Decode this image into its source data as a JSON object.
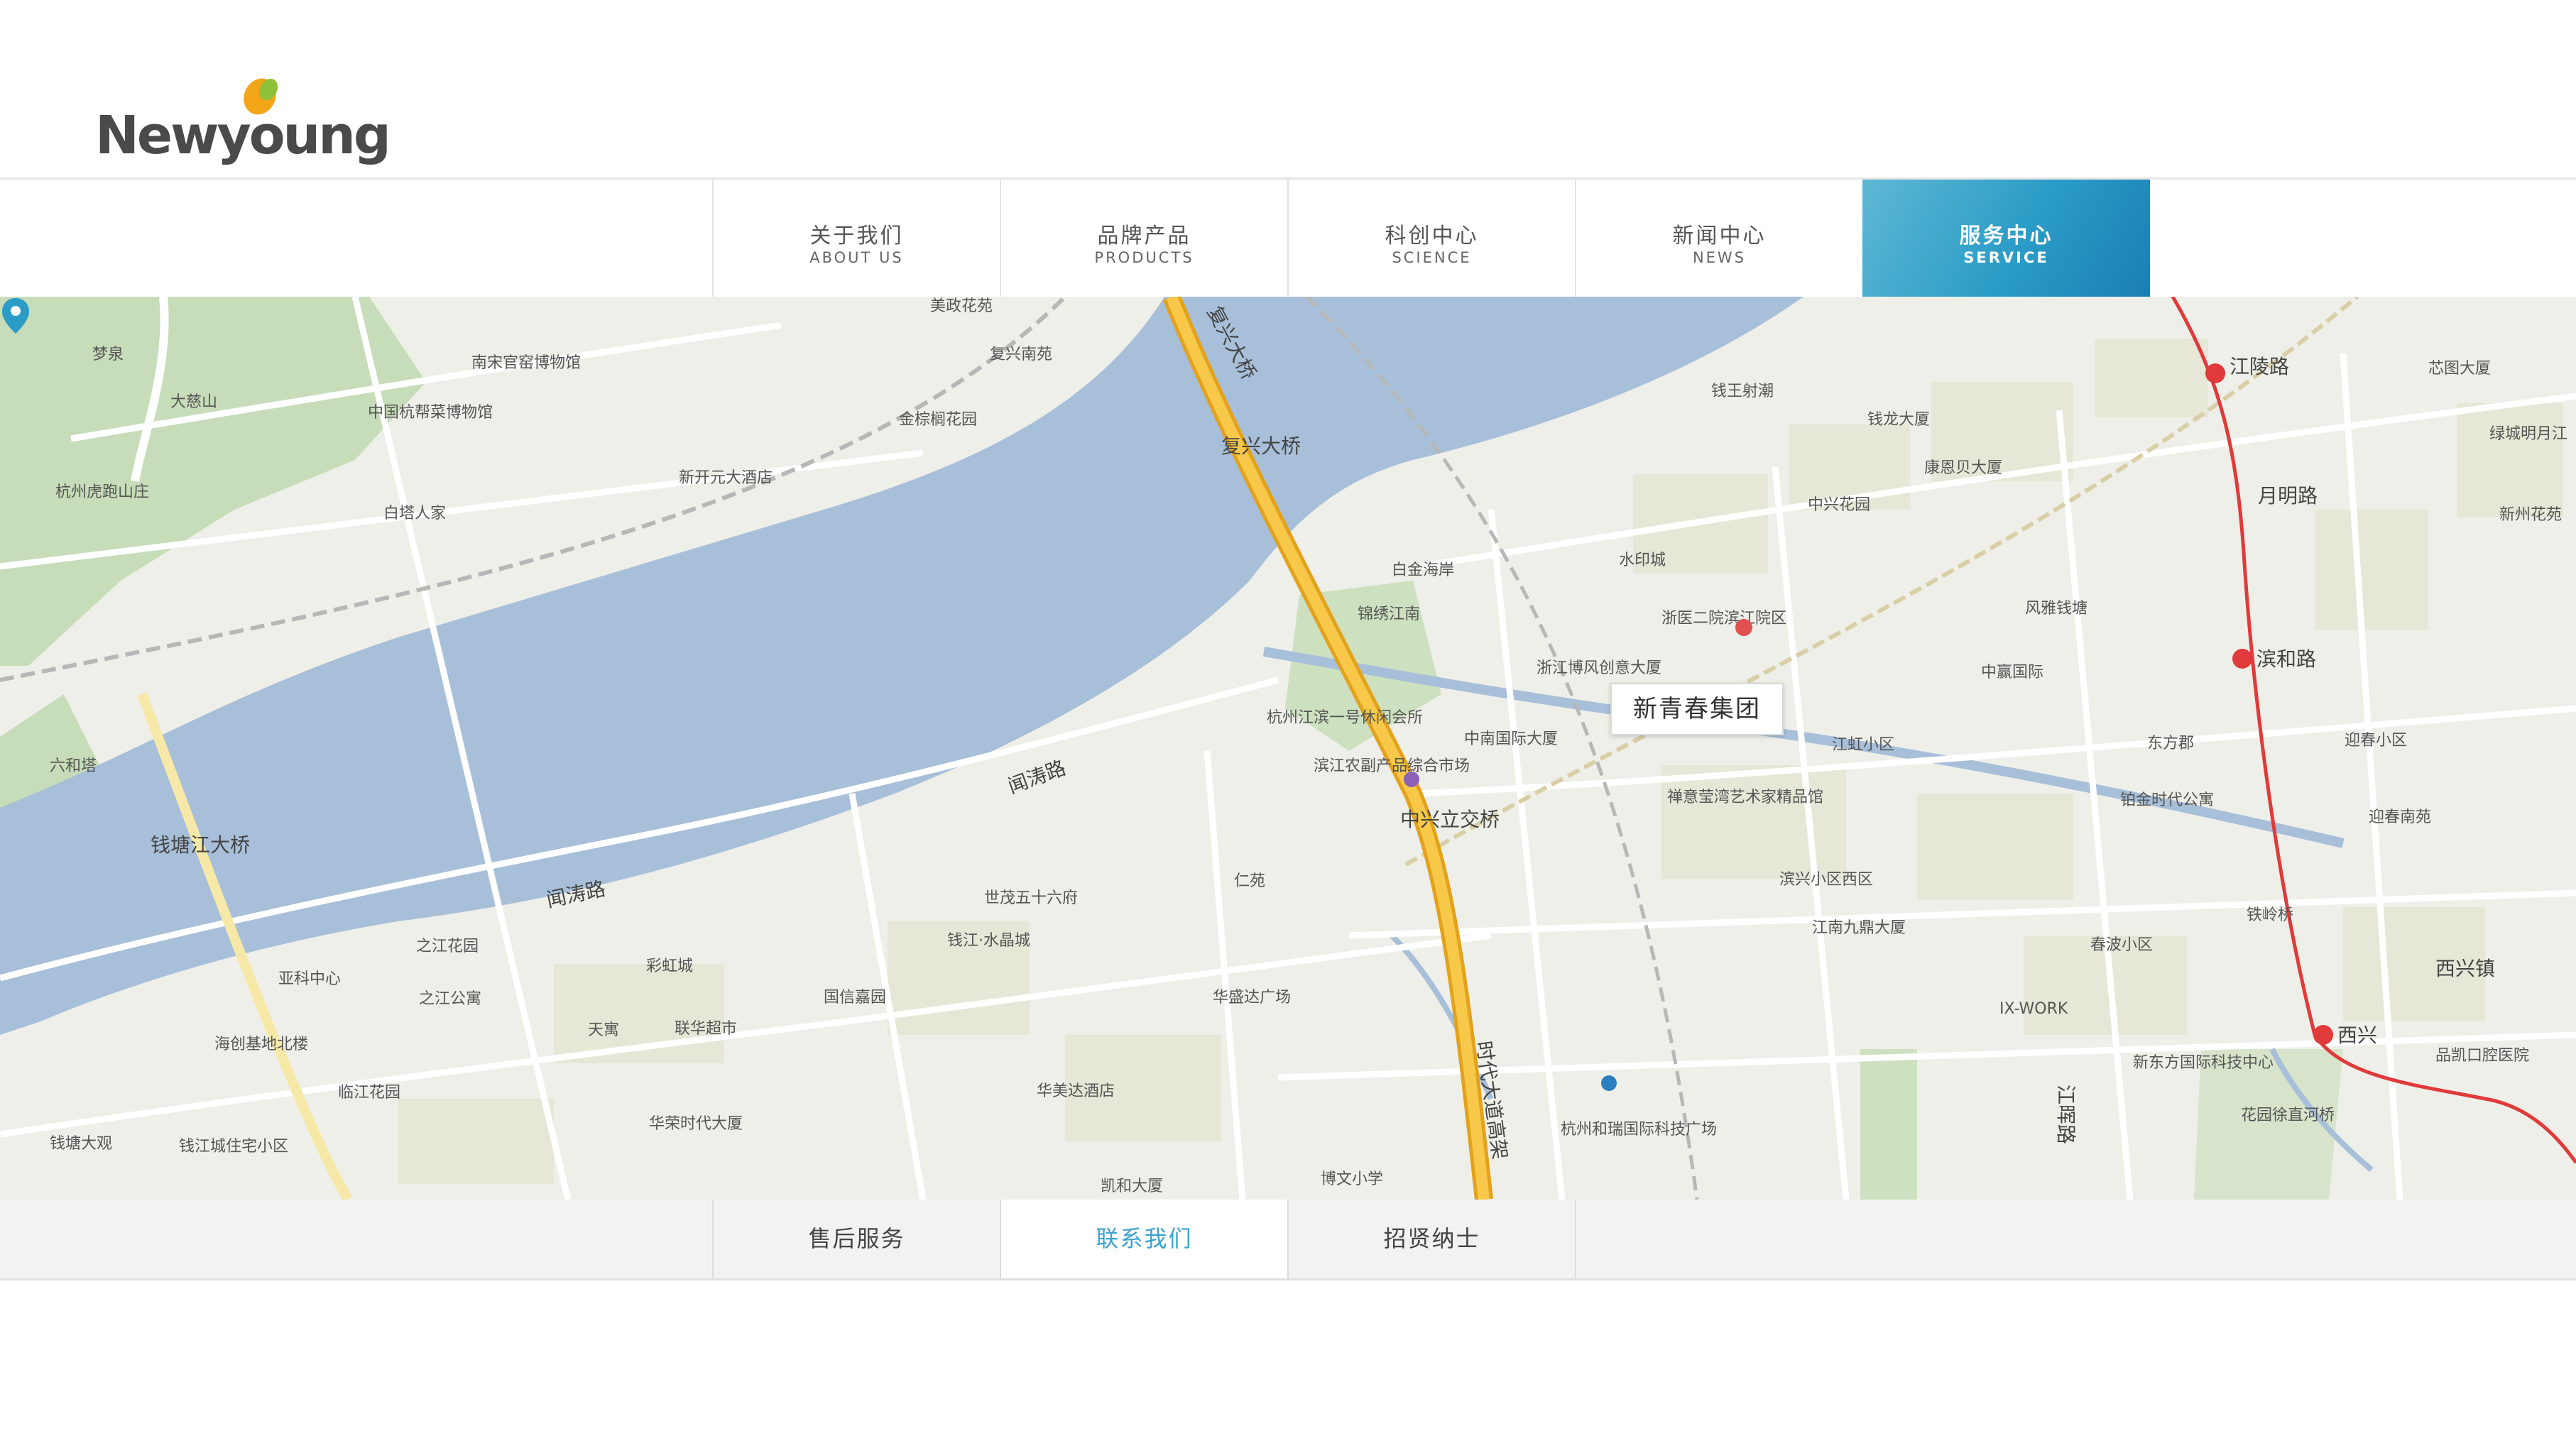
{
  "brand": {
    "name": "Newyoung"
  },
  "nav": {
    "items": [
      {
        "zh": "关于我们",
        "en": "ABOUT US"
      },
      {
        "zh": "品牌产品",
        "en": "PRODUCTS"
      },
      {
        "zh": "科创中心",
        "en": "SCIENCE"
      },
      {
        "zh": "新闻中心",
        "en": "NEWS"
      },
      {
        "zh": "服务中心",
        "en": "SERVICE",
        "active": true
      }
    ]
  },
  "map": {
    "marker_label": "新青春集团",
    "roads": {
      "fuxing_bridge_1": "复兴大桥",
      "fuxing_bridge_2": "复兴大桥",
      "minjiang": "闻涛路",
      "mintao2": "闻涛路",
      "qiantang_bridge": "钱塘江大桥",
      "zhongxing_interchange": "中兴立交桥",
      "shidai": "时代大道高架",
      "jianghui": "江晖路",
      "yueming": "月明路",
      "xixing": "西兴镇"
    },
    "metro": {
      "jiangling": "江陵路",
      "binhe": "滨和路",
      "xixing_station": "西兴"
    },
    "pois": [
      "梦泉",
      "大慈山",
      "中国杭帮菜博物馆",
      "杭州虎跑山庄",
      "南宋官窑博物馆",
      "美政花苑",
      "复兴南苑",
      "金棕榈花园",
      "新开元大酒店",
      "白塔人家",
      "六和塔",
      "钱王射潮",
      "钱龙大厦",
      "康恩贝大厦",
      "中兴花园",
      "水印城",
      "白金海岸",
      "锦绣江南",
      "浙医二院滨江院区",
      "浙江博风创意大厦",
      "中南国际大厦",
      "杭州江滨一号休闲会所",
      "滨江农副产品综合市场",
      "禅意莹湾艺术家精品馆",
      "江虹小区",
      "风雅钱塘",
      "中赢国际",
      "东方郡",
      "迎春小区",
      "铂金时代公寓",
      "迎春南苑",
      "芯图大厦",
      "绿城明月江",
      "新州花苑",
      "仁苑",
      "世茂五十六府",
      "钱江·水晶城",
      "滨兴小区西区",
      "江南九鼎大厦",
      "之江花园",
      "彩虹城",
      "亚科中心",
      "之江公寓",
      "天寓",
      "联华超市",
      "国信嘉园",
      "海创基地北楼",
      "华盛达广场",
      "春波小区",
      "铁岭桥",
      "IX-WORK",
      "临江花园",
      "华美达酒店",
      "华荣时代大厦",
      "钱塘大观",
      "钱江城住宅小区",
      "凯和大厦",
      "博文小学",
      "杭州和瑞国际科技广场",
      "新东方国际科技中心",
      "花园徐直河桥",
      "品凯口腔医院"
    ]
  },
  "subnav": {
    "items": [
      {
        "label": "售后服务"
      },
      {
        "label": "联系我们",
        "active": true
      },
      {
        "label": "招贤纳士"
      }
    ]
  },
  "colors": {
    "accent": "#2a9cc6",
    "water": "#a7bfd9",
    "green": "#c7dcb8",
    "expressway": "#f1b431",
    "metro": "#e03a3a"
  }
}
